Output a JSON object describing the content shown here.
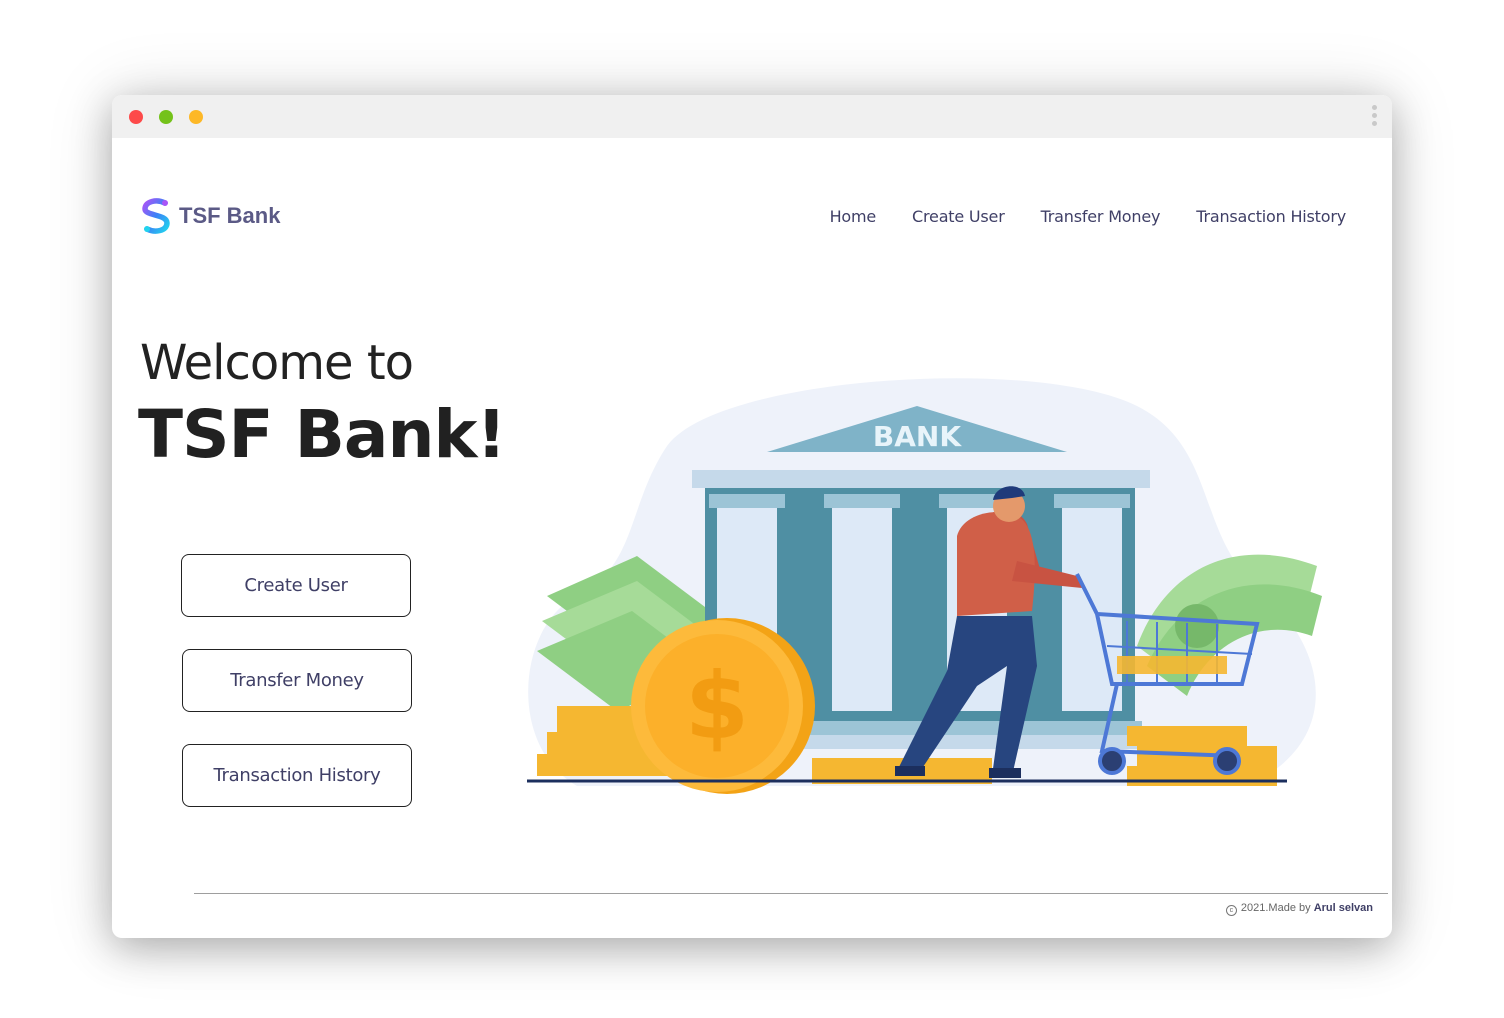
{
  "brand": {
    "name": "TSF Bank",
    "logo_icon": "s-swirl-logo-icon"
  },
  "nav": {
    "items": [
      "Home",
      "Create User",
      "Transfer Money",
      "Transaction History"
    ]
  },
  "hero": {
    "welcome": "Welcome to",
    "title": "TSF Bank!",
    "illustration_sign": "BANK"
  },
  "actions": {
    "create_user": "Create User",
    "transfer_money": "Transfer Money",
    "transaction_history": "Transaction History"
  },
  "footer": {
    "prefix": "2021.Made by",
    "author": "Arul selvan",
    "copyright_icon": "copyright-icon"
  },
  "colors": {
    "brand_text": "#5b5a86",
    "nav_text": "#3f3f66",
    "heading": "#222222",
    "dot_red": "#fd4a4a",
    "dot_green": "#74c21a",
    "dot_yellow": "#fdb827"
  }
}
